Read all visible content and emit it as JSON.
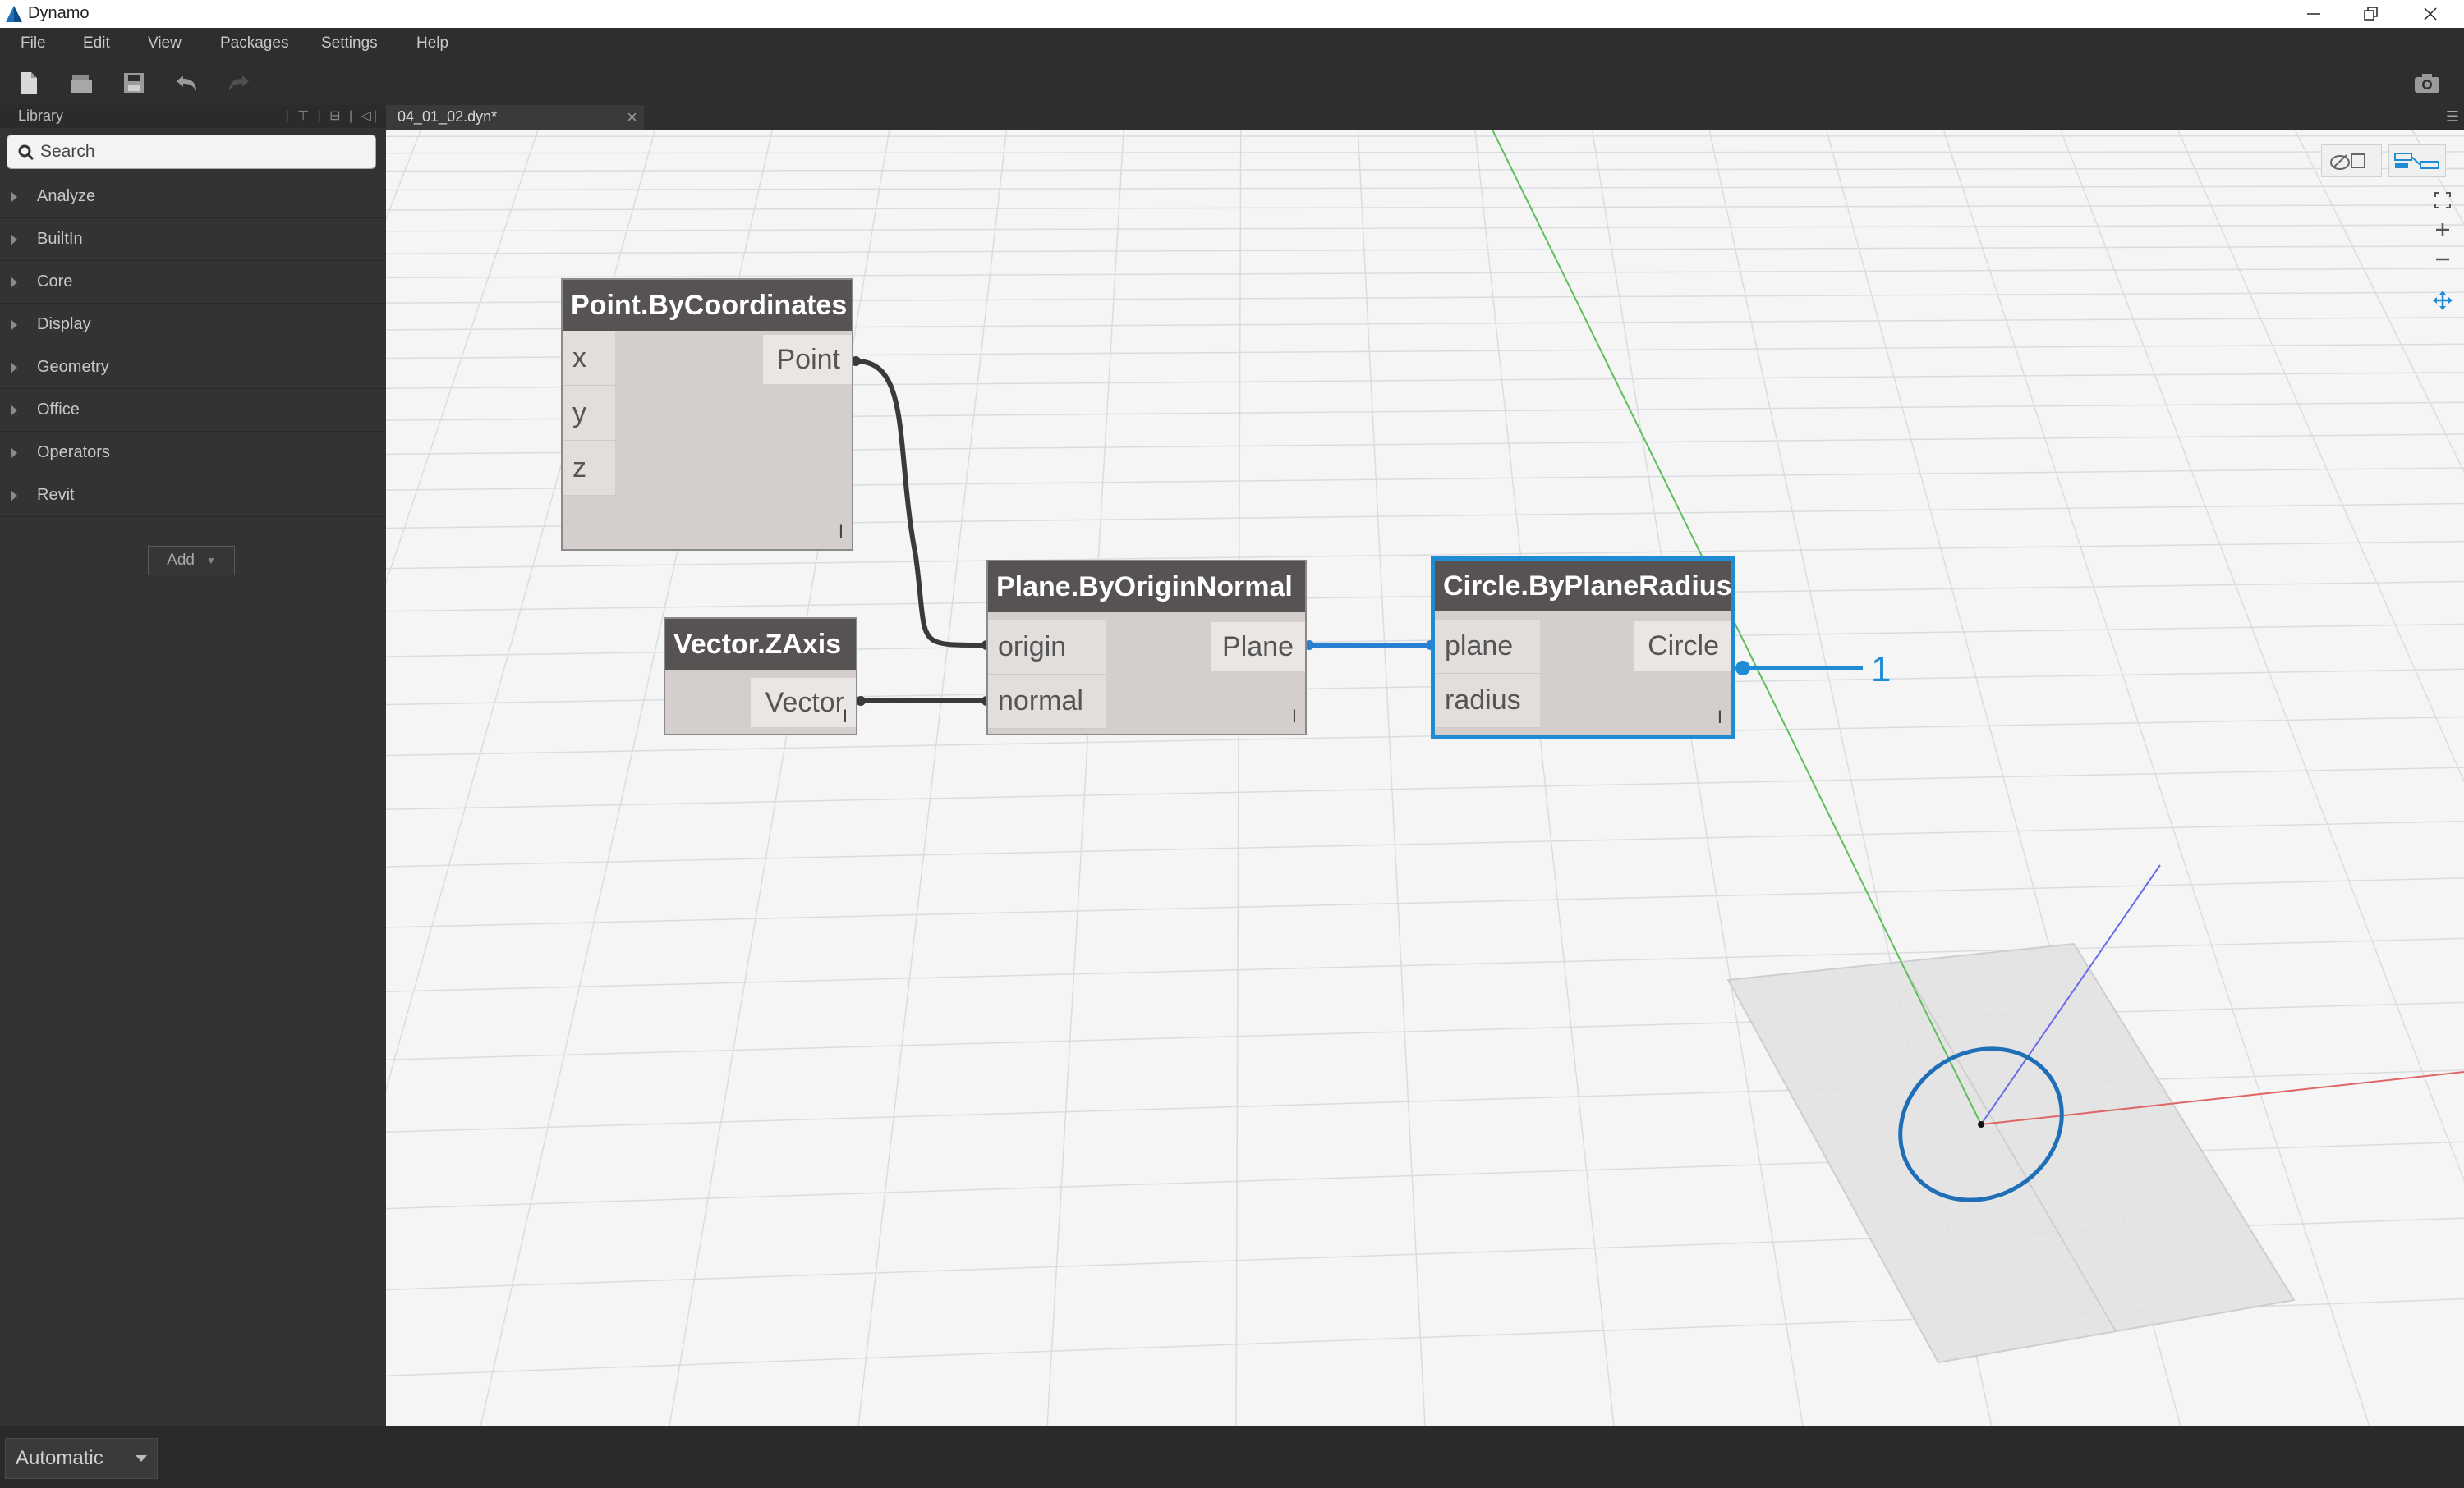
{
  "window": {
    "title": "Dynamo",
    "controls": [
      "—",
      "❐",
      "✕"
    ]
  },
  "menu": [
    "File",
    "Edit",
    "View",
    "Packages",
    "Settings",
    "Help"
  ],
  "toolbar": {
    "icons": [
      "new-file-icon",
      "open-file-icon",
      "save-icon",
      "undo-icon",
      "redo-icon"
    ],
    "right_icon": "camera-icon"
  },
  "library": {
    "title": "Library",
    "search_placeholder": "Search",
    "categories": [
      "Analyze",
      "BuiltIn",
      "Core",
      "Display",
      "Geometry",
      "Office",
      "Operators",
      "Revit"
    ],
    "add_label": "Add"
  },
  "tab": {
    "label": "04_01_02.dyn*"
  },
  "nodes": {
    "point": {
      "title": "Point.ByCoordinates",
      "inputs": [
        "x",
        "y",
        "z"
      ],
      "output": "Point",
      "lacing": "I"
    },
    "vector": {
      "title": "Vector.ZAxis",
      "output": "Vector",
      "lacing": "I"
    },
    "plane": {
      "title": "Plane.ByOriginNormal",
      "inputs": [
        "origin",
        "normal"
      ],
      "output": "Plane",
      "lacing": "I"
    },
    "circle": {
      "title": "Circle.ByPlaneRadius",
      "inputs": [
        "plane",
        "radius"
      ],
      "output": "Circle",
      "lacing": "I",
      "selected": true
    }
  },
  "callout": {
    "label": "1"
  },
  "run": {
    "mode": "Automatic"
  },
  "colors": {
    "accent": "#1e8bd4",
    "node_header": "#565352",
    "node_body": "#d4cfcc",
    "chrome": "#2e2e2e"
  }
}
